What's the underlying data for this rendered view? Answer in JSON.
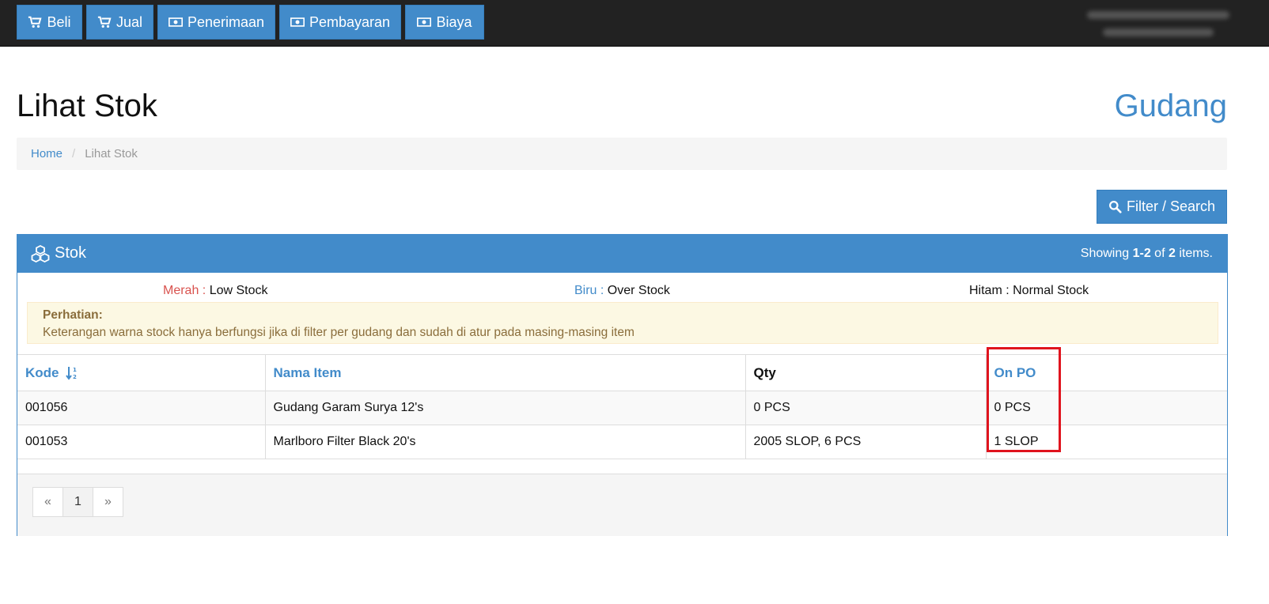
{
  "navbar": {
    "buttons": [
      {
        "label": "Beli",
        "icon": "cart-icon"
      },
      {
        "label": "Jual",
        "icon": "cart-icon"
      },
      {
        "label": "Penerimaan",
        "icon": "money-icon"
      },
      {
        "label": "Pembayaran",
        "icon": "money-icon"
      },
      {
        "label": "Biaya",
        "icon": "money-icon"
      }
    ]
  },
  "page": {
    "title": "Lihat Stok",
    "brand": "Gudang"
  },
  "breadcrumb": {
    "home": "Home",
    "separator": "/",
    "current": "Lihat Stok"
  },
  "filter": {
    "label": "Filter / Search",
    "icon": "search-icon"
  },
  "panel": {
    "title": "Stok",
    "icon": "cubes-icon",
    "summary": {
      "prefix": "Showing ",
      "range": "1-2",
      "mid": " of ",
      "total": "2",
      "suffix": " items."
    }
  },
  "legend": {
    "low": {
      "color_name": "Merah",
      "label": "Low Stock"
    },
    "over": {
      "color_name": "Biru",
      "label": "Over Stock"
    },
    "normal": {
      "color_name": "Hitam",
      "label": "Normal Stock"
    },
    "separator": " : "
  },
  "alert": {
    "title": "Perhatian:",
    "message": "Keterangan warna stock hanya berfungsi jika di filter per gudang dan sudah di atur pada masing-masing item"
  },
  "table": {
    "headers": {
      "kode": "Kode",
      "nama": "Nama Item",
      "qty": "Qty",
      "on_po": "On PO"
    },
    "rows": [
      {
        "kode": "001056",
        "nama": "Gudang Garam Surya 12's",
        "qty": "0 PCS",
        "on_po": "0 PCS"
      },
      {
        "kode": "001053",
        "nama": "Marlboro Filter Black 20's",
        "qty": "2005 SLOP, 6 PCS",
        "on_po": "1 SLOP"
      }
    ]
  },
  "pagination": {
    "prev": "«",
    "page": "1",
    "next": "»"
  },
  "colors": {
    "primary": "#428bca",
    "navbar": "#222222",
    "danger": "#d9534f",
    "warning_bg": "#fcf8e3",
    "warning_text": "#8a6d3b",
    "highlight": "#e0141e"
  }
}
